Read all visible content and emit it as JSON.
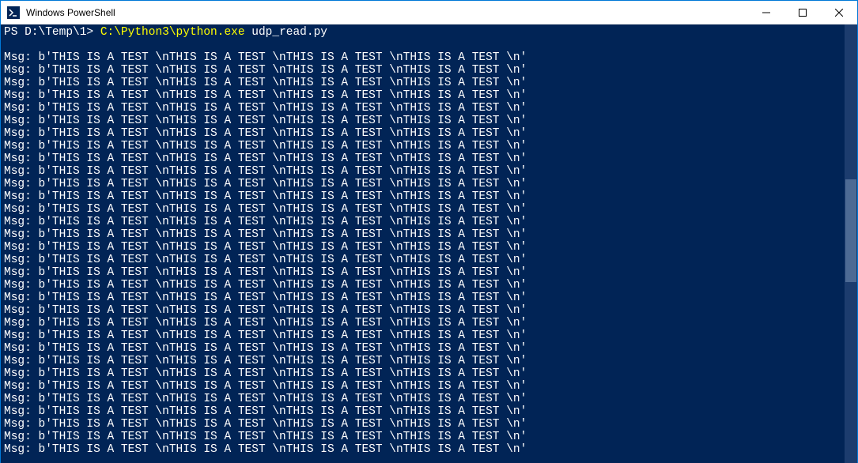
{
  "window": {
    "title": "Windows PowerShell"
  },
  "prompt": {
    "path": "PS D:\\Temp\\1>",
    "command": "C:\\Python3\\python.exe",
    "args": "udp_read.py"
  },
  "output": {
    "blank_line": "",
    "msg_line": "Msg: b'THIS IS A TEST \\nTHIS IS A TEST \\nTHIS IS A TEST \\nTHIS IS A TEST \\n'",
    "repeat_count": 32
  }
}
